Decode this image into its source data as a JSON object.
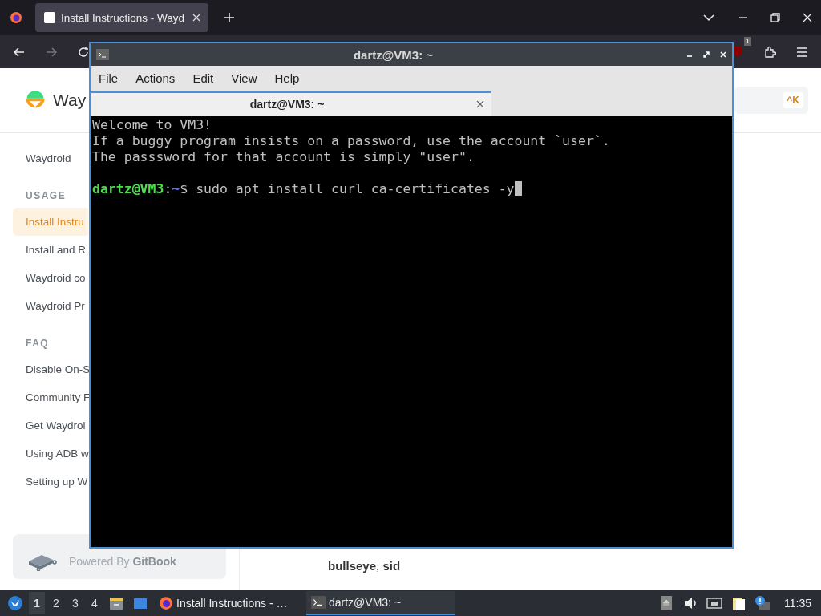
{
  "browser": {
    "tabs": [
      {
        "title": "Install Instructions - Wayd",
        "selected": true
      }
    ],
    "nav": {
      "forward_disabled": true
    },
    "extension_badge": "1"
  },
  "page": {
    "logo_text": "Way",
    "search_shortcut": "^K",
    "sidebar": {
      "items": [
        {
          "kind": "link",
          "label": "Waydroid",
          "selected": false
        },
        {
          "kind": "heading",
          "label": "USAGE"
        },
        {
          "kind": "link",
          "label": "Install Instru",
          "selected": true
        },
        {
          "kind": "link",
          "label": "Install and R",
          "selected": false
        },
        {
          "kind": "link",
          "label": "Waydroid co",
          "selected": false
        },
        {
          "kind": "link",
          "label": "Waydroid Pr",
          "selected": false
        },
        {
          "kind": "heading",
          "label": "FAQ"
        },
        {
          "kind": "link",
          "label": "Disable On-S",
          "selected": false
        },
        {
          "kind": "link",
          "label": "Community F",
          "selected": false
        },
        {
          "kind": "link",
          "label": "Get Waydroi",
          "selected": false
        },
        {
          "kind": "link",
          "label": "Using ADB w",
          "selected": false
        },
        {
          "kind": "link",
          "label": "Setting up W",
          "selected": false
        }
      ]
    },
    "powered_by": "Powered By **GitBook**",
    "content_text": "**bullseye**, **sid**"
  },
  "terminal": {
    "title": "dartz@VM3: ~",
    "menu": [
      "File",
      "Actions",
      "Edit",
      "View",
      "Help"
    ],
    "tabs": [
      {
        "title": "dartz@VM3: ~",
        "selected": true
      }
    ],
    "lines": [
      {
        "kind": "text",
        "text": "Welcome to VM3!"
      },
      {
        "kind": "text",
        "text": "If a buggy program insists on a password, use the account `user`."
      },
      {
        "kind": "text",
        "text": "The passsword for that account is simply \"user\"."
      },
      {
        "kind": "blank"
      },
      {
        "kind": "prompt",
        "user_host": "dartz@VM3",
        "separator": ":",
        "path": "~",
        "command": "$ sudo apt install curl ca-certificates -y",
        "cursor": true
      }
    ]
  },
  "taskbar": {
    "workspaces": [
      {
        "label": "1",
        "selected": true
      },
      {
        "label": "2",
        "selected": false
      },
      {
        "label": "3",
        "selected": false
      },
      {
        "label": "4",
        "selected": false
      }
    ],
    "tasks": [
      {
        "kind": "browser",
        "label": "Install Instructions - …",
        "selected": false
      },
      {
        "kind": "terminal",
        "label": "dartz@VM3: ~",
        "selected": true
      }
    ],
    "clock": "11:35"
  }
}
